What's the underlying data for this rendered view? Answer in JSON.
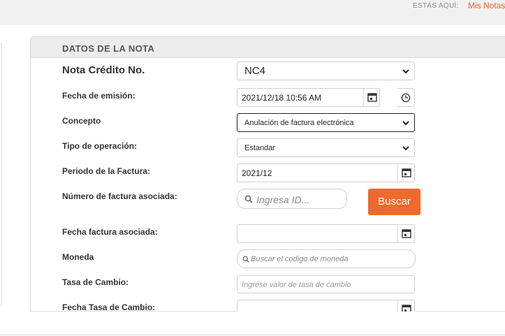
{
  "breadcrumb": {
    "label": "ESTÁS AQUÍ:",
    "current": "Mis Notas"
  },
  "section": {
    "title": "DATOS DE LA NOTA"
  },
  "form": {
    "nota_credito": {
      "label": "Nota Crédito No.",
      "value": "NC4"
    },
    "fecha_emision": {
      "label": "Fecha de emisión:",
      "value": "2021/12/18 10:56 AM"
    },
    "concepto": {
      "label": "Concepto",
      "value": "Anulación de factura electrónica"
    },
    "tipo_operacion": {
      "label": "Tipo de operación:",
      "value": "Estandar"
    },
    "periodo_factura": {
      "label": "Periodo de la Factura:",
      "value": "2021/12"
    },
    "numero_factura": {
      "label": "Número de factura asociada:",
      "placeholder": "Ingresa ID...",
      "button": "Buscar"
    },
    "fecha_factura": {
      "label": "Fecha factura asociada:",
      "value": ""
    },
    "moneda": {
      "label": "Moneda",
      "placeholder": "Buscar el codigo de moneda"
    },
    "tasa_cambio": {
      "label": "Tasa de Cambio:",
      "placeholder": "Ingrese valor de tasa de cambio"
    },
    "fecha_tasa": {
      "label": "Fecha Tasa de Cambio:",
      "value": ""
    }
  },
  "colors": {
    "accent": "#ee6a2c",
    "link": "#e8632a",
    "header_bg": "#ececec"
  },
  "icons": [
    "calendar-icon",
    "clock-icon",
    "chevron-down-icon",
    "search-icon"
  ]
}
